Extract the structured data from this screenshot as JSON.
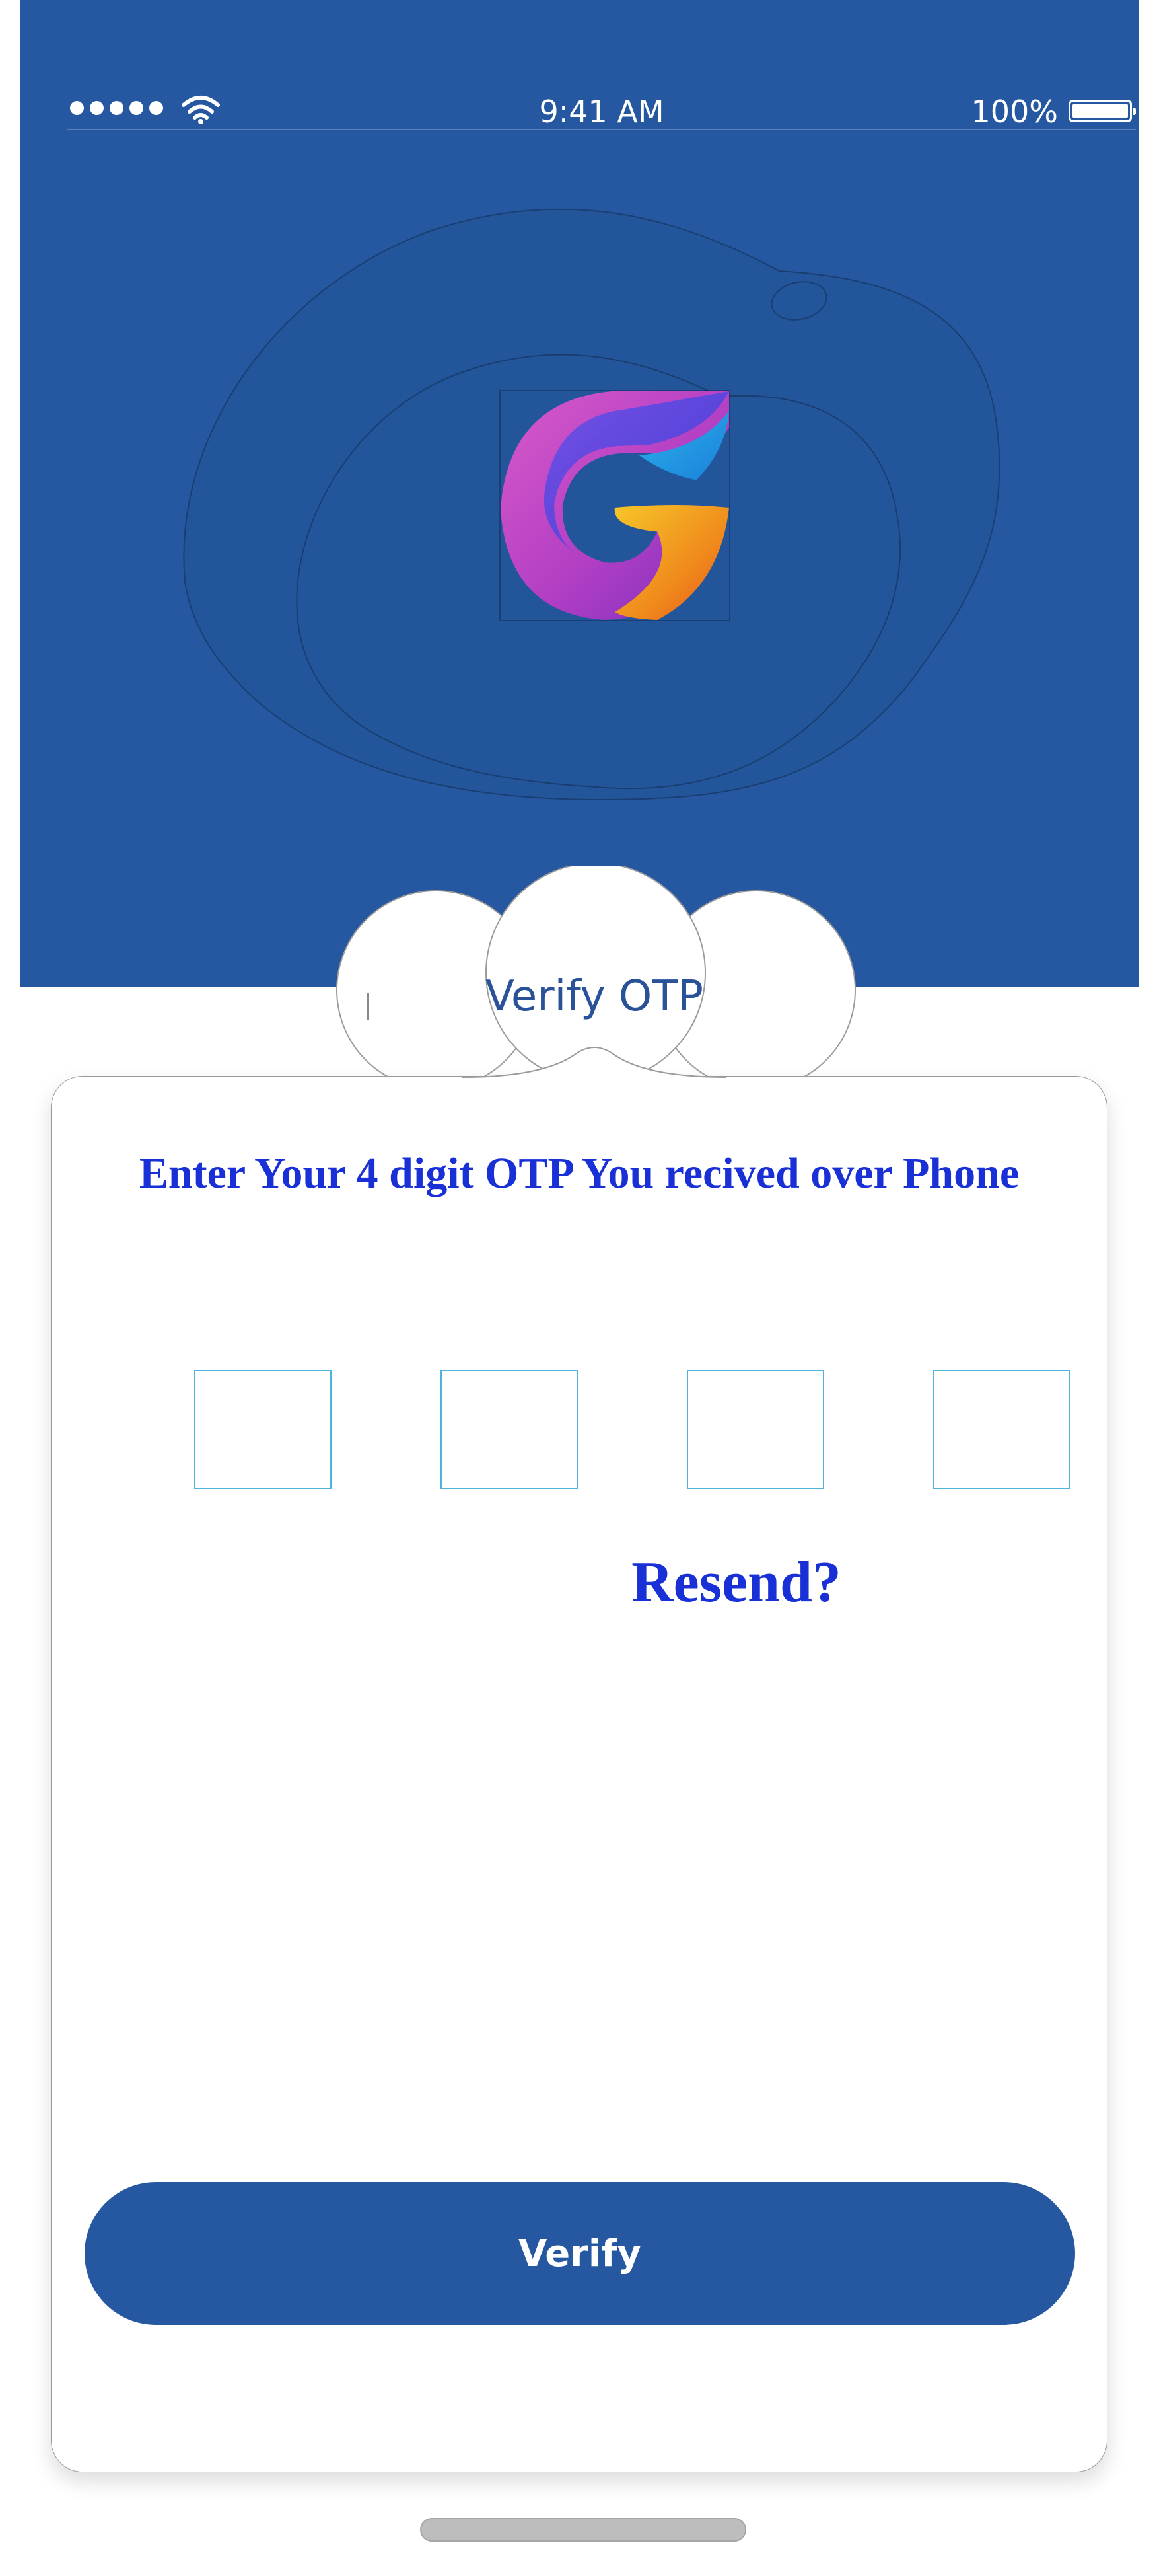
{
  "status_bar": {
    "time": "9:41 AM",
    "battery_percent": "100%",
    "battery_level": 1.0,
    "signal_icon": "signal-dots-icon",
    "wifi_icon": "wifi-icon",
    "battery_icon": "battery-icon"
  },
  "header": {
    "logo_icon": "app-logo-g-icon",
    "title": "Verify OTP"
  },
  "otp_form": {
    "instruction": "Enter Your 4 digit OTP  You recived over Phone",
    "digits": [
      "",
      "",
      "",
      ""
    ],
    "resend_label": "Resend?",
    "verify_label": "Verify"
  },
  "colors": {
    "primary": "#2558a0",
    "instruction_text": "#1930d6",
    "otp_box_border": "#4fb3de",
    "background": "#ffffff"
  }
}
